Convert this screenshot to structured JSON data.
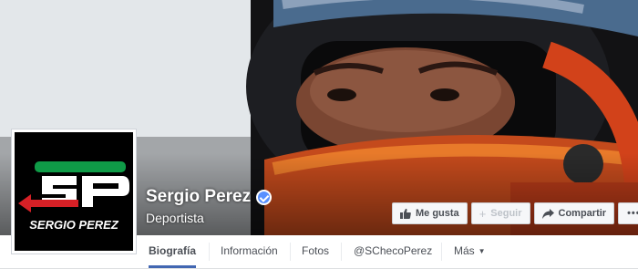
{
  "page": {
    "name": "Sergio Perez",
    "category": "Deportista"
  },
  "logo": {
    "initials": "SP",
    "text": "SERGIO PEREZ"
  },
  "actions": {
    "like_label": "Me gusta",
    "follow_label": "Seguir",
    "share_label": "Compartir",
    "more_label": "•••"
  },
  "tabs": [
    {
      "label": "Biografía",
      "active": true
    },
    {
      "label": "Información"
    },
    {
      "label": "Fotos"
    },
    {
      "label": "@SChecoPerez"
    },
    {
      "label": "Más"
    }
  ],
  "colors": {
    "accent": "#4267b2",
    "verified": "#5890ff",
    "logo_green": "#0f9b47",
    "logo_red": "#d62026"
  },
  "icons": {
    "verified": "verified-badge-icon",
    "like": "thumbs-up-icon",
    "follow": "plus-icon",
    "share": "share-arrow-icon",
    "more": "ellipsis-icon"
  }
}
